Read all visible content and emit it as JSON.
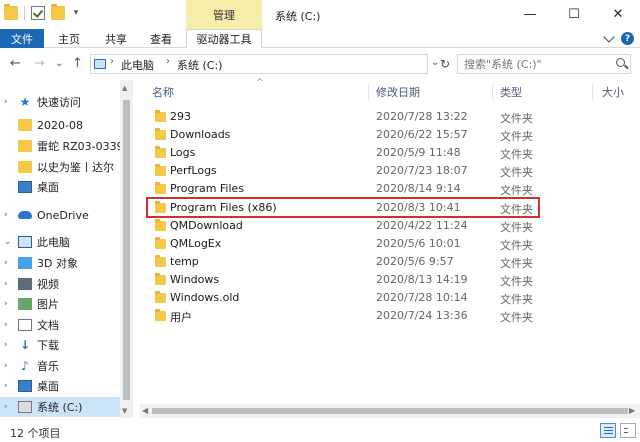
{
  "window": {
    "title": "系统 (C:)",
    "context_tab": "管理",
    "controls": {
      "minimize": "—",
      "maximize": "☐",
      "close": "✕"
    }
  },
  "ribbon": {
    "tabs": [
      "文件",
      "主页",
      "共享",
      "查看"
    ],
    "context_tab": "驱动器工具"
  },
  "address": {
    "crumbs": [
      "此电脑",
      "系统 (C:)"
    ],
    "search_placeholder": "搜索\"系统 (C:)\""
  },
  "nav": {
    "back": "←",
    "forward": "→",
    "recent": "⌄",
    "up": "↑"
  },
  "sidebar": {
    "items": [
      {
        "label": "快速访问",
        "icon": "star-icon"
      },
      {
        "label": "2020-08",
        "icon": "folder-icon"
      },
      {
        "label": "雷蛇 RZ03-0339",
        "icon": "folder-icon"
      },
      {
        "label": "以史为鉴丨达尔",
        "icon": "folder-icon"
      },
      {
        "label": "桌面",
        "icon": "desktop-icon"
      },
      {
        "label": "OneDrive",
        "icon": "cloud-icon"
      },
      {
        "label": "此电脑",
        "icon": "pc-icon"
      },
      {
        "label": "3D 对象",
        "icon": "3d-objects-icon"
      },
      {
        "label": "视频",
        "icon": "video-icon"
      },
      {
        "label": "图片",
        "icon": "pictures-icon"
      },
      {
        "label": "文档",
        "icon": "documents-icon"
      },
      {
        "label": "下载",
        "icon": "download-icon"
      },
      {
        "label": "音乐",
        "icon": "music-icon"
      },
      {
        "label": "桌面",
        "icon": "desktop-icon"
      },
      {
        "label": "系统 (C:)",
        "icon": "drive-icon"
      }
    ]
  },
  "columns": {
    "name": "名称",
    "date": "修改日期",
    "type": "类型",
    "size": "大小"
  },
  "files": [
    {
      "name": "293",
      "date": "2020/7/28 13:22",
      "type": "文件夹"
    },
    {
      "name": "Downloads",
      "date": "2020/6/22 15:57",
      "type": "文件夹"
    },
    {
      "name": "Logs",
      "date": "2020/5/9 11:48",
      "type": "文件夹"
    },
    {
      "name": "PerfLogs",
      "date": "2020/7/23 18:07",
      "type": "文件夹"
    },
    {
      "name": "Program Files",
      "date": "2020/8/14 9:14",
      "type": "文件夹"
    },
    {
      "name": "Program Files (x86)",
      "date": "2020/8/3 10:41",
      "type": "文件夹"
    },
    {
      "name": "QMDownload",
      "date": "2020/4/22 11:24",
      "type": "文件夹"
    },
    {
      "name": "QMLogEx",
      "date": "2020/5/6 10:01",
      "type": "文件夹"
    },
    {
      "name": "temp",
      "date": "2020/5/6 9:57",
      "type": "文件夹"
    },
    {
      "name": "Windows",
      "date": "2020/8/13 14:19",
      "type": "文件夹"
    },
    {
      "name": "Windows.old",
      "date": "2020/7/28 10:14",
      "type": "文件夹"
    },
    {
      "name": "用户",
      "date": "2020/7/24 13:36",
      "type": "文件夹"
    }
  ],
  "status": {
    "count": "12 个项目"
  },
  "colors": {
    "accent": "#1b67b4",
    "context_tab": "#f6edab",
    "highlight_border": "#d0312d",
    "selection": "#cce4f7"
  }
}
